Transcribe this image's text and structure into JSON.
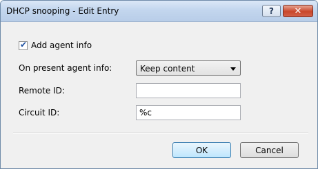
{
  "window": {
    "title": "DHCP snooping - Edit Entry",
    "help_label": "?",
    "close_label": "✕"
  },
  "form": {
    "add_agent_info": {
      "label": "Add agent info",
      "checked": true
    },
    "on_present_agent_info": {
      "label": "On present agent info:",
      "selected": "Keep content"
    },
    "remote_id": {
      "label": "Remote ID:",
      "value": ""
    },
    "circuit_id": {
      "label": "Circuit ID:",
      "value": "%c"
    }
  },
  "buttons": {
    "ok_label": "OK",
    "cancel_label": "Cancel"
  },
  "icons": {
    "help": "question-mark-icon",
    "close": "close-icon",
    "dropdown": "chevron-down-icon",
    "checkbox": "checkmark-icon"
  },
  "colors": {
    "title_bar": "#c3d6ee",
    "close_button": "#c9462a",
    "dialog_background": "#f0f0f0",
    "default_button": "#bee6fd"
  }
}
